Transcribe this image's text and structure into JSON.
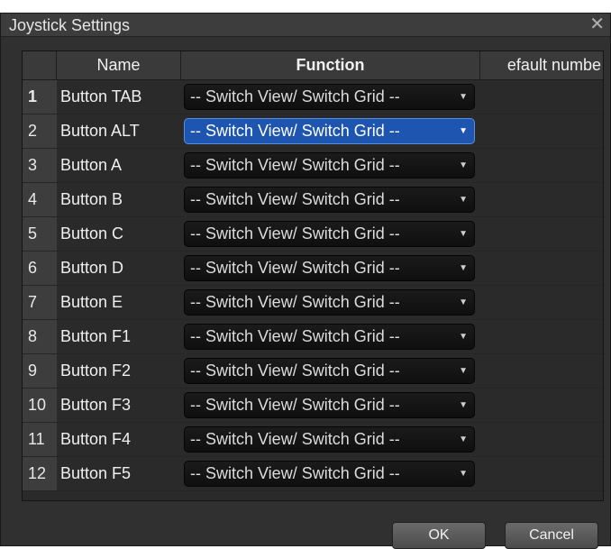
{
  "dialog": {
    "title": "Joystick Settings",
    "close_icon": "close-icon"
  },
  "table": {
    "headers": {
      "num": "",
      "name": "Name",
      "function": "Function",
      "default": "efault numbe"
    },
    "rows": [
      {
        "num": "1",
        "name": "Button TAB",
        "function": "-- Switch View/ Switch Grid --"
      },
      {
        "num": "2",
        "name": "Button ALT",
        "function": "-- Switch View/ Switch Grid --"
      },
      {
        "num": "3",
        "name": "Button A",
        "function": "-- Switch View/ Switch Grid --"
      },
      {
        "num": "4",
        "name": "Button B",
        "function": "-- Switch View/ Switch Grid --"
      },
      {
        "num": "5",
        "name": "Button C",
        "function": "-- Switch View/ Switch Grid --"
      },
      {
        "num": "6",
        "name": "Button D",
        "function": "-- Switch View/ Switch Grid --"
      },
      {
        "num": "7",
        "name": "Button E",
        "function": "-- Switch View/ Switch Grid --"
      },
      {
        "num": "8",
        "name": "Button F1",
        "function": "-- Switch View/ Switch Grid --"
      },
      {
        "num": "9",
        "name": "Button F2",
        "function": "-- Switch View/ Switch Grid --"
      },
      {
        "num": "10",
        "name": "Button F3",
        "function": "-- Switch View/ Switch Grid --"
      },
      {
        "num": "11",
        "name": "Button F4",
        "function": "-- Switch View/ Switch Grid --"
      },
      {
        "num": "12",
        "name": "Button F5",
        "function": "-- Switch View/ Switch Grid --"
      }
    ],
    "dropdown_arrow_icon": "chevron-down-icon"
  },
  "buttons": {
    "ok": "OK",
    "cancel": "Cancel"
  },
  "colors": {
    "selected_dropdown": "#1d55b0",
    "dialog_bg": "#303030"
  }
}
